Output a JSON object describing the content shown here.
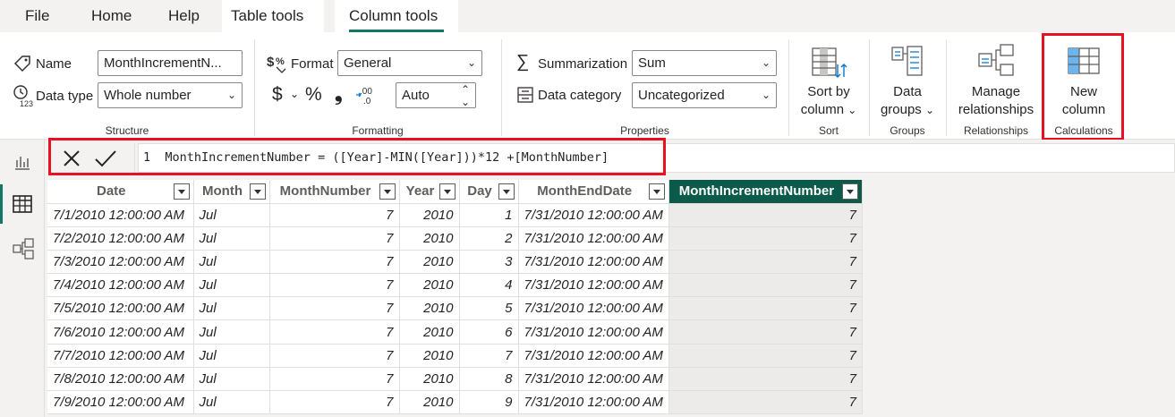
{
  "tabs": {
    "file": "File",
    "home": "Home",
    "help": "Help",
    "table_tools": "Table tools",
    "column_tools": "Column tools"
  },
  "structure": {
    "name_label": "Name",
    "name_value": "MonthIncrementN...",
    "datatype_label": "Data type",
    "datatype_value": "Whole number",
    "group_label": "Structure"
  },
  "formatting": {
    "format_label": "Format",
    "format_value": "General",
    "currency": "$",
    "percent": "%",
    "comma": "❟",
    "decimals_value": "Auto",
    "group_label": "Formatting"
  },
  "properties": {
    "summarization_label": "Summarization",
    "summarization_value": "Sum",
    "category_label": "Data category",
    "category_value": "Uncategorized",
    "group_label": "Properties"
  },
  "sort": {
    "button_line1": "Sort by",
    "button_line2": "column",
    "group_label": "Sort"
  },
  "groups": {
    "button_line1": "Data",
    "button_line2": "groups",
    "group_label": "Groups"
  },
  "relationships": {
    "button_line1": "Manage",
    "button_line2": "relationships",
    "group_label": "Relationships"
  },
  "calculations": {
    "button_line1": "New",
    "button_line2": "column",
    "group_label": "Calculations"
  },
  "formula": {
    "text": "1  MonthIncrementNumber = ([Year]-MIN([Year]))*12 +[MonthNumber]"
  },
  "table": {
    "headers": [
      "Date",
      "Month",
      "MonthNumber",
      "Year",
      "Day",
      "MonthEndDate",
      "MonthIncrementNumber"
    ],
    "rows": [
      [
        "7/1/2010 12:00:00 AM",
        "Jul",
        "7",
        "2010",
        "1",
        "7/31/2010 12:00:00 AM",
        "7"
      ],
      [
        "7/2/2010 12:00:00 AM",
        "Jul",
        "7",
        "2010",
        "2",
        "7/31/2010 12:00:00 AM",
        "7"
      ],
      [
        "7/3/2010 12:00:00 AM",
        "Jul",
        "7",
        "2010",
        "3",
        "7/31/2010 12:00:00 AM",
        "7"
      ],
      [
        "7/4/2010 12:00:00 AM",
        "Jul",
        "7",
        "2010",
        "4",
        "7/31/2010 12:00:00 AM",
        "7"
      ],
      [
        "7/5/2010 12:00:00 AM",
        "Jul",
        "7",
        "2010",
        "5",
        "7/31/2010 12:00:00 AM",
        "7"
      ],
      [
        "7/6/2010 12:00:00 AM",
        "Jul",
        "7",
        "2010",
        "6",
        "7/31/2010 12:00:00 AM",
        "7"
      ],
      [
        "7/7/2010 12:00:00 AM",
        "Jul",
        "7",
        "2010",
        "7",
        "7/31/2010 12:00:00 AM",
        "7"
      ],
      [
        "7/8/2010 12:00:00 AM",
        "Jul",
        "7",
        "2010",
        "8",
        "7/31/2010 12:00:00 AM",
        "7"
      ],
      [
        "7/9/2010 12:00:00 AM",
        "Jul",
        "7",
        "2010",
        "9",
        "7/31/2010 12:00:00 AM",
        "7"
      ]
    ]
  },
  "colors": {
    "accent": "#117865",
    "selected_header": "#0b5a4a",
    "highlight": "#e81123"
  }
}
